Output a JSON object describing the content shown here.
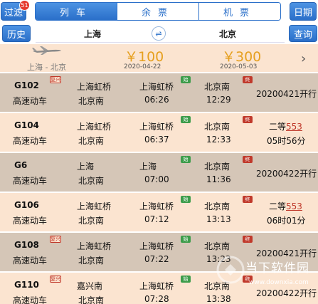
{
  "toolbar": {
    "filter_label": "过滤",
    "filter_badge": "51",
    "tabs": [
      {
        "label": "列车",
        "active": true
      },
      {
        "label": "余票",
        "active": false
      },
      {
        "label": "机票",
        "active": false
      }
    ],
    "date_label": "日期"
  },
  "search": {
    "history_label": "历史",
    "from": "上海",
    "to": "北京",
    "query_label": "查询"
  },
  "flight_prices": {
    "route": "上海 - 北京",
    "offers": [
      {
        "price": "￥100",
        "date": "2020-04-22"
      },
      {
        "price": "￥300",
        "date": "2020-05-03"
      }
    ]
  },
  "tags": {
    "fuxing": "复兴",
    "shi": "始",
    "zhong": "终"
  },
  "trains": [
    {
      "no": "G102",
      "type": "高速动车",
      "from_station": "上海虹桥",
      "to_station": "北京南",
      "depart_station": "上海虹桥",
      "depart_time": "06:26",
      "arrive_station": "北京南",
      "arrive_time": "12:29",
      "status": "20200421开行",
      "fuxing": true
    },
    {
      "no": "G104",
      "type": "高速动车",
      "from_station": "上海虹桥",
      "to_station": "北京南",
      "depart_station": "上海虹桥",
      "depart_time": "06:37",
      "arrive_station": "北京南",
      "arrive_time": "12:33",
      "seat_class": "二等",
      "seat_count": "553",
      "duration": "05时56分",
      "fuxing": false
    },
    {
      "no": "G6",
      "type": "高速动车",
      "from_station": "上海",
      "to_station": "北京南",
      "depart_station": "上海",
      "depart_time": "07:00",
      "arrive_station": "北京南",
      "arrive_time": "11:36",
      "status": "20200422开行",
      "fuxing": false
    },
    {
      "no": "G106",
      "type": "高速动车",
      "from_station": "上海虹桥",
      "to_station": "北京南",
      "depart_station": "上海虹桥",
      "depart_time": "07:12",
      "arrive_station": "北京南",
      "arrive_time": "13:13",
      "seat_class": "二等",
      "seat_count": "553",
      "duration": "06时01分",
      "fuxing": false
    },
    {
      "no": "G108",
      "type": "高速动车",
      "from_station": "上海虹桥",
      "to_station": "北京南",
      "depart_station": "上海虹桥",
      "depart_time": "07:22",
      "arrive_station": "北京南",
      "arrive_time": "13:23",
      "status": "20200421开行",
      "fuxing": true
    },
    {
      "no": "G110",
      "type": "高速动车",
      "from_station": "嘉兴南",
      "to_station": "北京南",
      "depart_station": "上海虹桥",
      "depart_time": "07:28",
      "arrive_station": "北京南",
      "arrive_time": "13:38",
      "status": "20200422开行",
      "fuxing": true
    }
  ],
  "watermark": {
    "text": "当下软件园",
    "url": "www.downxia.com"
  },
  "colors": {
    "accent": "#2a6fc9",
    "row_dark": "#d5c6b7",
    "row_light": "#fbe4d0",
    "price": "#e6a020",
    "seat_count": "#c0392b"
  }
}
